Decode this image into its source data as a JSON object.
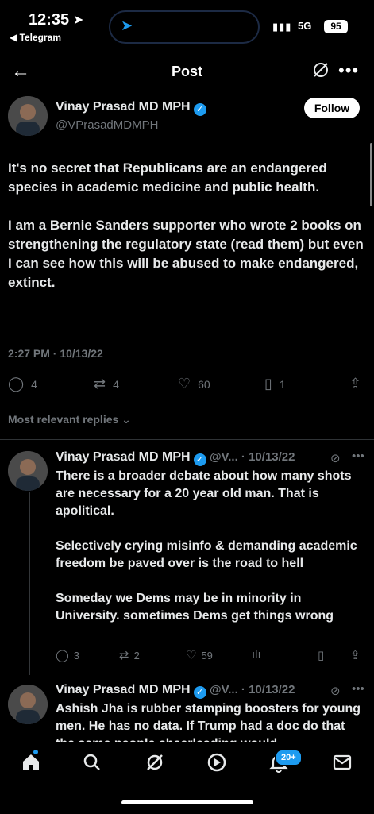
{
  "status_bar": {
    "time": "12:35",
    "back_app": "◀ Telegram",
    "network": "5G",
    "battery": "95"
  },
  "header": {
    "title": "Post"
  },
  "post": {
    "author_name": "Vinay Prasad MD MPH",
    "handle": "@VPrasadMDMPH",
    "follow_label": "Follow",
    "paragraphs": [
      "It's no secret that Republicans are an endangered species in academic medicine and public health.",
      "I am a Bernie Sanders supporter who wrote 2 books on strengthening the regulatory state (read them) but even I can see how this will be abused to make endangered, extinct."
    ],
    "timestamp": "2:27 PM · 10/13/22",
    "replies": "4",
    "reposts": "4",
    "likes": "60",
    "bookmarks": "1"
  },
  "sort_label": "Most relevant replies",
  "replies": [
    {
      "author_name": "Vinay Prasad MD MPH",
      "handle_date": "@V... · 10/13/22",
      "paragraphs": [
        "There is a broader debate about how many shots are necessary for a 20 year old man. That is apolitical.",
        "Selectively crying misinfo & demanding academic freedom be paved over is the road to hell",
        "Someday we Dems may be in minority in University. sometimes Dems get things wrong"
      ],
      "replies": "3",
      "reposts": "2",
      "likes": "59"
    },
    {
      "author_name": "Vinay Prasad MD MPH",
      "handle_date": "@V... · 10/13/22",
      "text": "Ashish Jha is rubber stamping boosters for young men. He has no data. If Trump had a doc do that the same people cheerleading would"
    }
  ],
  "tabbar": {
    "notifications_badge": "20+"
  },
  "colors": {
    "accent": "#1d9bf0",
    "muted": "#71767b",
    "background": "#000000"
  }
}
